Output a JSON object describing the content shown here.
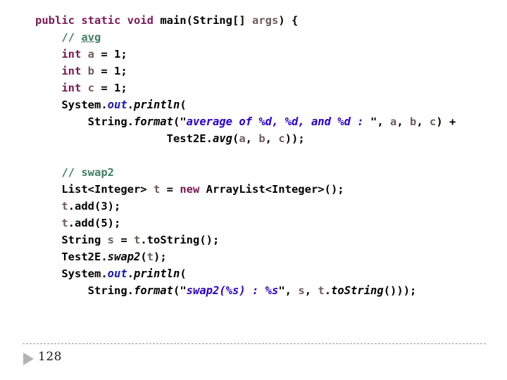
{
  "slide": {
    "page_number": "128",
    "nav_icon": "play-triangle-icon"
  },
  "colors": {
    "background": "#ffffff",
    "keyword": "#7a1a55",
    "comment": "#3f7f5f",
    "string": "#2a00c8",
    "variable": "#6f5b57",
    "field": "#1a1ab0",
    "plain": "#000000",
    "rule": "#9a9a9a",
    "nav_icon": "#b3b3b3"
  },
  "code": {
    "language": "java",
    "full_text": "public static void main(String[] args) {\n    // avg\n    int a = 1;\n    int b = 1;\n    int c = 1;\n    System.out.println(\n        String.format(\"average of %d, %d, and %d : \", a, b, c) +\n                    Test2E.avg(a, b, c));\n\n    // swap2\n    List<Integer> t = new ArrayList<Integer>();\n    t.add(3);\n    t.add(5);\n    String s = t.toString();\n    Test2E.swap2(t);\n    System.out.println(\n        String.format(\"swap2(%s) : %s\", s, t.toString()));",
    "lines": [
      {
        "id": "line-1",
        "tokens": [
          {
            "t": "public static void ",
            "c": "kw"
          },
          {
            "t": "main",
            "c": "plain"
          },
          {
            "t": "(",
            "c": "plain"
          },
          {
            "t": "String",
            "c": "plain"
          },
          {
            "t": "[] ",
            "c": "plain"
          },
          {
            "t": "args",
            "c": "var"
          },
          {
            "t": ") {",
            "c": "plain"
          }
        ]
      },
      {
        "id": "line-2",
        "tokens": [
          {
            "t": "    ",
            "c": "plain"
          },
          {
            "t": "// ",
            "c": "cmt"
          },
          {
            "t": "avg",
            "c": "cmt-u"
          }
        ]
      },
      {
        "id": "line-3",
        "tokens": [
          {
            "t": "    ",
            "c": "plain"
          },
          {
            "t": "int",
            "c": "kw"
          },
          {
            "t": " ",
            "c": "plain"
          },
          {
            "t": "a",
            "c": "var"
          },
          {
            "t": " = 1;",
            "c": "plain"
          }
        ]
      },
      {
        "id": "line-4",
        "tokens": [
          {
            "t": "    ",
            "c": "plain"
          },
          {
            "t": "int",
            "c": "kw"
          },
          {
            "t": " ",
            "c": "plain"
          },
          {
            "t": "b",
            "c": "var"
          },
          {
            "t": " = 1;",
            "c": "plain"
          }
        ]
      },
      {
        "id": "line-5",
        "tokens": [
          {
            "t": "    ",
            "c": "plain"
          },
          {
            "t": "int",
            "c": "kw"
          },
          {
            "t": " ",
            "c": "plain"
          },
          {
            "t": "c",
            "c": "var"
          },
          {
            "t": " = 1;",
            "c": "plain"
          }
        ]
      },
      {
        "id": "line-6",
        "tokens": [
          {
            "t": "    System.",
            "c": "plain"
          },
          {
            "t": "out",
            "c": "field"
          },
          {
            "t": ".",
            "c": "plain"
          },
          {
            "t": "println",
            "c": "method"
          },
          {
            "t": "(",
            "c": "plain"
          }
        ]
      },
      {
        "id": "line-7",
        "tokens": [
          {
            "t": "        String.",
            "c": "plain"
          },
          {
            "t": "format",
            "c": "method"
          },
          {
            "t": "(",
            "c": "plain"
          },
          {
            "t": "\"",
            "c": "plain"
          },
          {
            "t": "average of %d, %d, and %d : ",
            "c": "str"
          },
          {
            "t": "\"",
            "c": "plain"
          },
          {
            "t": ", ",
            "c": "plain"
          },
          {
            "t": "a",
            "c": "var"
          },
          {
            "t": ", ",
            "c": "plain"
          },
          {
            "t": "b",
            "c": "var"
          },
          {
            "t": ", ",
            "c": "plain"
          },
          {
            "t": "c",
            "c": "var"
          },
          {
            "t": ") +",
            "c": "plain"
          }
        ]
      },
      {
        "id": "line-8",
        "tokens": [
          {
            "t": "                    Test2E.",
            "c": "plain"
          },
          {
            "t": "avg",
            "c": "method"
          },
          {
            "t": "(",
            "c": "plain"
          },
          {
            "t": "a",
            "c": "var"
          },
          {
            "t": ", ",
            "c": "plain"
          },
          {
            "t": "b",
            "c": "var"
          },
          {
            "t": ", ",
            "c": "plain"
          },
          {
            "t": "c",
            "c": "var"
          },
          {
            "t": "));",
            "c": "plain"
          }
        ]
      },
      {
        "id": "line-9",
        "blank": true,
        "tokens": []
      },
      {
        "id": "line-10",
        "tokens": [
          {
            "t": "    ",
            "c": "plain"
          },
          {
            "t": "// swap2",
            "c": "cmt"
          }
        ]
      },
      {
        "id": "line-11",
        "tokens": [
          {
            "t": "    List<Integer> ",
            "c": "plain"
          },
          {
            "t": "t",
            "c": "var"
          },
          {
            "t": " = ",
            "c": "plain"
          },
          {
            "t": "new",
            "c": "kw"
          },
          {
            "t": " ArrayList<Integer>();",
            "c": "plain"
          }
        ]
      },
      {
        "id": "line-12",
        "tokens": [
          {
            "t": "    ",
            "c": "plain"
          },
          {
            "t": "t",
            "c": "var"
          },
          {
            "t": ".",
            "c": "plain"
          },
          {
            "t": "add",
            "c": "plain"
          },
          {
            "t": "(3);",
            "c": "plain"
          }
        ]
      },
      {
        "id": "line-13",
        "tokens": [
          {
            "t": "    ",
            "c": "plain"
          },
          {
            "t": "t",
            "c": "var"
          },
          {
            "t": ".",
            "c": "plain"
          },
          {
            "t": "add",
            "c": "plain"
          },
          {
            "t": "(5);",
            "c": "plain"
          }
        ]
      },
      {
        "id": "line-14",
        "tokens": [
          {
            "t": "    String ",
            "c": "plain"
          },
          {
            "t": "s",
            "c": "var"
          },
          {
            "t": " = ",
            "c": "plain"
          },
          {
            "t": "t",
            "c": "var"
          },
          {
            "t": ".toString();",
            "c": "plain"
          }
        ]
      },
      {
        "id": "line-15",
        "tokens": [
          {
            "t": "    Test2E.",
            "c": "plain"
          },
          {
            "t": "swap2",
            "c": "method"
          },
          {
            "t": "(",
            "c": "plain"
          },
          {
            "t": "t",
            "c": "var"
          },
          {
            "t": ");",
            "c": "plain"
          }
        ]
      },
      {
        "id": "line-16",
        "tokens": [
          {
            "t": "    System.",
            "c": "plain"
          },
          {
            "t": "out",
            "c": "field"
          },
          {
            "t": ".",
            "c": "plain"
          },
          {
            "t": "println",
            "c": "method"
          },
          {
            "t": "(",
            "c": "plain"
          }
        ]
      },
      {
        "id": "line-17",
        "tokens": [
          {
            "t": "        String.",
            "c": "plain"
          },
          {
            "t": "format",
            "c": "method"
          },
          {
            "t": "(",
            "c": "plain"
          },
          {
            "t": "\"",
            "c": "plain"
          },
          {
            "t": "swap2(%s) : %s",
            "c": "str"
          },
          {
            "t": "\"",
            "c": "plain"
          },
          {
            "t": ", ",
            "c": "plain"
          },
          {
            "t": "s",
            "c": "var"
          },
          {
            "t": ", ",
            "c": "plain"
          },
          {
            "t": "t",
            "c": "var"
          },
          {
            "t": ".",
            "c": "plain"
          },
          {
            "t": "toString",
            "c": "method"
          },
          {
            "t": "()));",
            "c": "plain"
          }
        ]
      }
    ]
  }
}
